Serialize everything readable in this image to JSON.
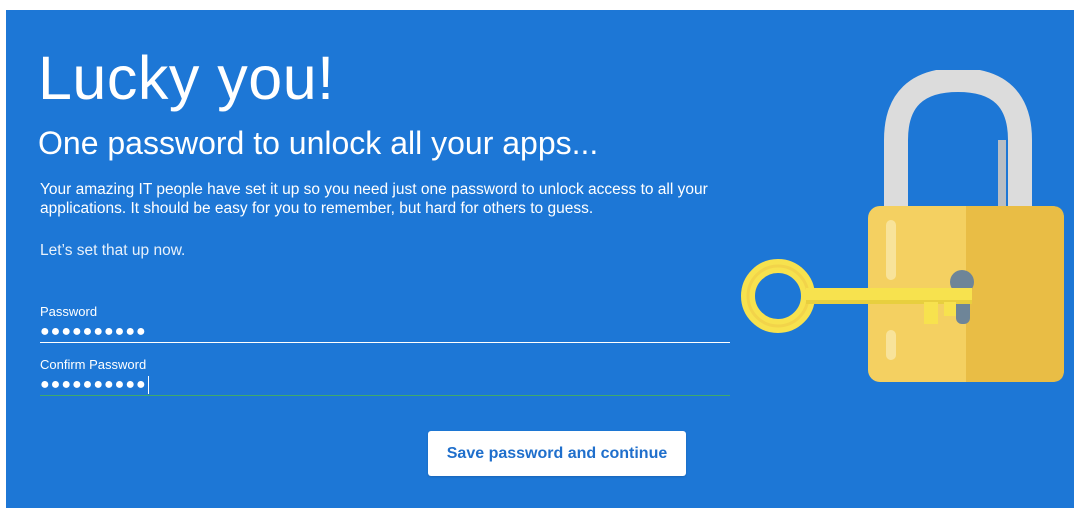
{
  "hero": {
    "title": "Lucky you!",
    "subtitle": "One password to unlock all your apps...",
    "description": "Your amazing IT people have set it up so you need just one password to unlock access to all your applications. It should be easy for you to remember, but hard for others to guess.",
    "cta_text": "Let’s set that up now."
  },
  "form": {
    "password": {
      "label": "Password",
      "masked_value": "●●●●●●●●●●"
    },
    "confirm_password": {
      "label": "Confirm Password",
      "masked_value": "●●●●●●●●●●"
    },
    "submit_label": "Save password and continue"
  },
  "illustration": {
    "icon": "padlock-with-key-icon"
  },
  "colors": {
    "background": "#1d77d6",
    "button_text": "#1f6fcc",
    "button_bg": "#ffffff",
    "confirm_underline": "#3fa96c",
    "lock_body": "#f4d061",
    "lock_shackle": "#dcdcdc",
    "key": "#f7e24e"
  }
}
